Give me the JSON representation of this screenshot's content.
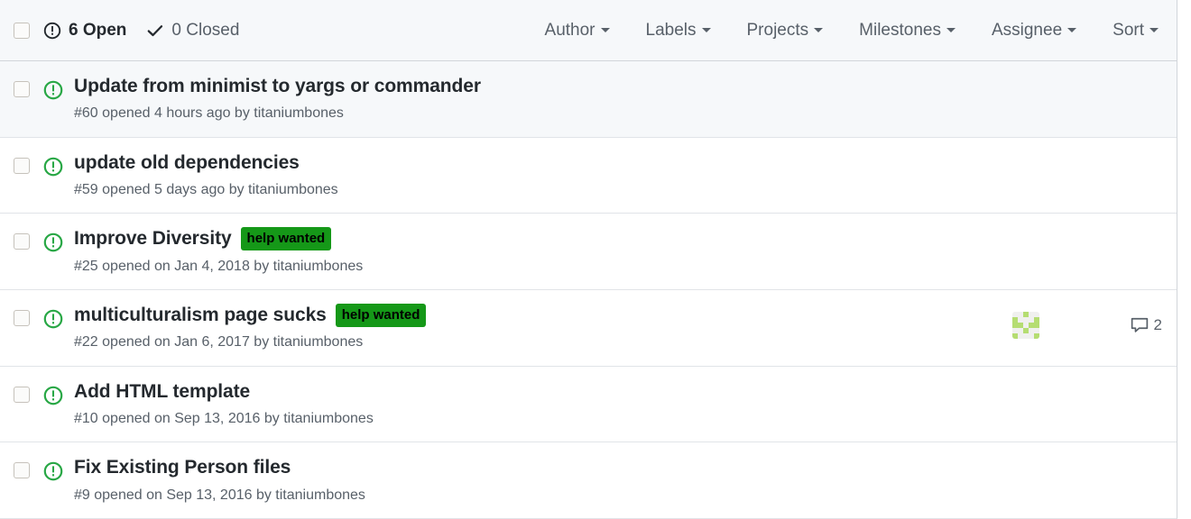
{
  "header": {
    "select_all_checkbox": "select-all",
    "state_filters": [
      {
        "icon": "issue-opened-icon",
        "label": "6 Open",
        "selected": true
      },
      {
        "icon": "check-icon",
        "label": "0 Closed",
        "selected": false
      }
    ],
    "dropdowns": [
      {
        "label": "Author"
      },
      {
        "label": "Labels"
      },
      {
        "label": "Projects"
      },
      {
        "label": "Milestones"
      },
      {
        "label": "Assignee"
      },
      {
        "label": "Sort"
      }
    ]
  },
  "colors": {
    "open_icon_green": "#28a745",
    "label_help_wanted_bg": "#159818",
    "label_help_wanted_fg": "#000000",
    "header_bg": "#f6f8fa",
    "meta_text": "#586069",
    "title_text": "#24292e",
    "border": "#e1e4e8",
    "identicon_green": "#b5dd72"
  },
  "issues": [
    {
      "icon": "issue-opened-icon",
      "title": "Update from minimist to yargs or commander",
      "meta": "#60 opened 4 hours ago by titaniumbones",
      "number": "#60",
      "labels": [],
      "assignee": null,
      "comments": null,
      "highlighted": true
    },
    {
      "icon": "issue-opened-icon",
      "title": "update old dependencies",
      "meta": "#59 opened 5 days ago by titaniumbones",
      "number": "#59",
      "labels": [],
      "assignee": null,
      "comments": null,
      "highlighted": false
    },
    {
      "icon": "issue-opened-icon",
      "title": "Improve Diversity",
      "meta": "#25 opened on Jan 4, 2018 by titaniumbones",
      "number": "#25",
      "labels": [
        {
          "name": "help wanted",
          "bg": "#159818",
          "fg": "#000000"
        }
      ],
      "assignee": null,
      "comments": null,
      "highlighted": false
    },
    {
      "icon": "issue-opened-icon",
      "title": "multiculturalism page sucks",
      "meta": "#22 opened on Jan 6, 2017 by titaniumbones",
      "number": "#22",
      "labels": [
        {
          "name": "help wanted",
          "bg": "#159818",
          "fg": "#000000"
        }
      ],
      "assignee": "identicon-avatar",
      "comments": "2",
      "highlighted": false
    },
    {
      "icon": "issue-opened-icon",
      "title": "Add HTML template",
      "meta": "#10 opened on Sep 13, 2016 by titaniumbones",
      "number": "#10",
      "labels": [],
      "assignee": null,
      "comments": null,
      "highlighted": false
    },
    {
      "icon": "issue-opened-icon",
      "title": "Fix Existing Person files",
      "meta": "#9 opened on Sep 13, 2016 by titaniumbones",
      "number": "#9",
      "labels": [],
      "assignee": null,
      "comments": null,
      "highlighted": false
    }
  ],
  "identicon_pattern": [
    [
      0,
      0,
      1,
      0,
      0
    ],
    [
      1,
      0,
      0,
      0,
      1
    ],
    [
      1,
      1,
      0,
      1,
      1
    ],
    [
      0,
      0,
      1,
      0,
      0
    ],
    [
      1,
      0,
      0,
      0,
      1
    ]
  ]
}
